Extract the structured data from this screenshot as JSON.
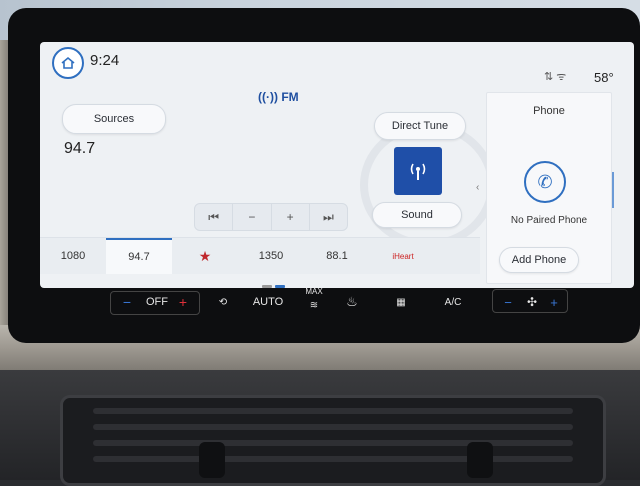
{
  "status": {
    "time": "9:24",
    "temperature": "58°",
    "icons": "⇅ ᯤ"
  },
  "radio": {
    "band": "FM",
    "frequency": "94.7",
    "sources_label": "Sources",
    "direct_tune_label": "Direct Tune",
    "sound_label": "Sound",
    "controls": [
      "⏮",
      "−",
      "+",
      "⏭"
    ]
  },
  "presets": [
    "1080",
    "94.7",
    "★",
    "1350",
    "88.1",
    "iHeart"
  ],
  "active_preset": "94.7",
  "phone": {
    "title": "Phone",
    "status": "No Paired Phone",
    "add_label": "Add Phone"
  },
  "climate": {
    "minus": "−",
    "off_label": "OFF",
    "plus": "+",
    "auto_label": "AUTO",
    "max_label": "MAX",
    "ac_label": "A/C",
    "fan_minus": "−",
    "fan_plus": "+"
  },
  "colors": {
    "accent": "#2f6fc0",
    "tile": "#1f4fa8",
    "minus": "#3a78d8",
    "plus": "#e0303a"
  }
}
